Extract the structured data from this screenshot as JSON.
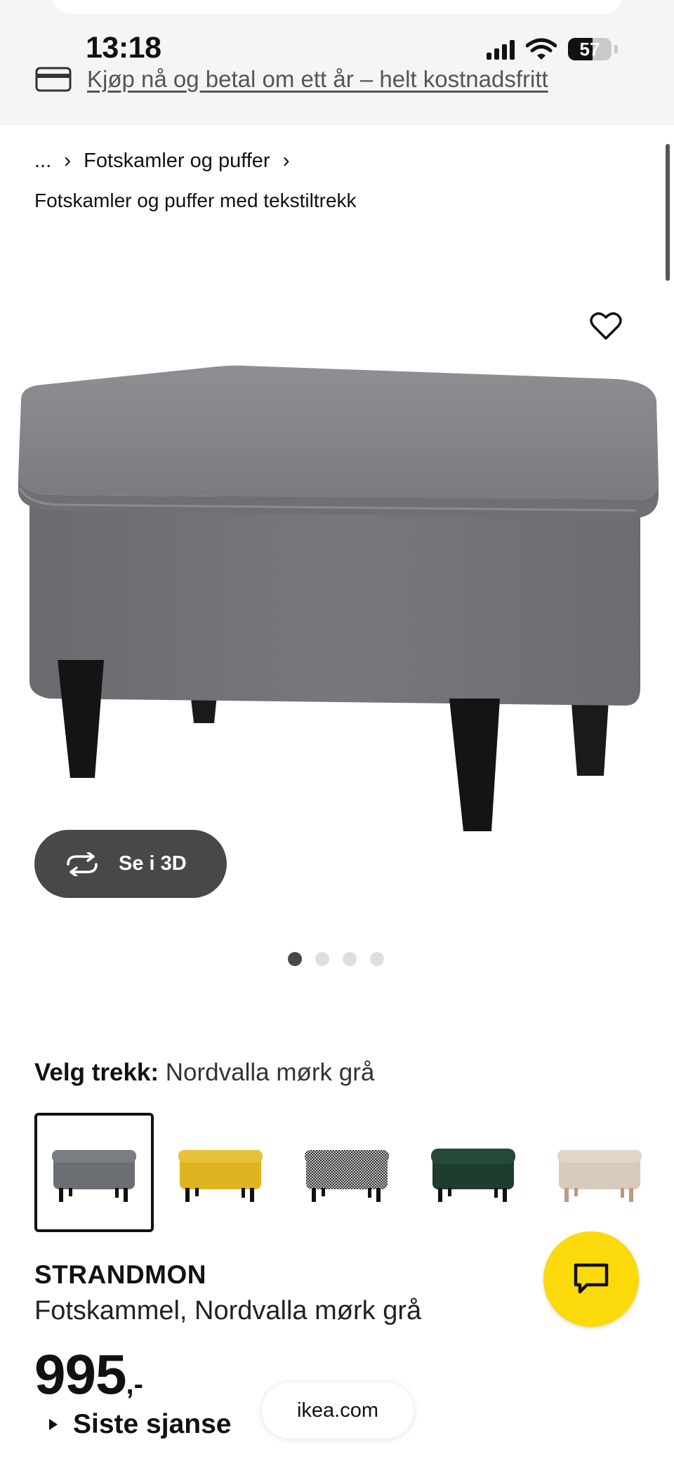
{
  "status_bar": {
    "time": "13:18",
    "battery": "57"
  },
  "promo": {
    "text": "Kjøp nå og betal om ett år – helt kostnadsfritt",
    "icon": "credit-card-icon"
  },
  "breadcrumb": {
    "ellipsis": "...",
    "category": "Fotskamler og puffer"
  },
  "subcategory": "Fotskamler og puffer med tekstiltrekk",
  "view_3d": {
    "label": "Se i 3D",
    "icon": "rotate-3d-icon"
  },
  "carousel": {
    "total": 4,
    "active_index": 0
  },
  "cover": {
    "label": "Velg trekk:",
    "value": "Nordvalla mørk grå"
  },
  "swatches": [
    {
      "color": "#6b6e72",
      "selected": true
    },
    {
      "color": "#e0b321",
      "selected": false
    },
    {
      "color": "#8d8d8d",
      "selected": false
    },
    {
      "color": "#1f3d2f",
      "selected": false
    },
    {
      "color": "#d7cbbb",
      "selected": false
    }
  ],
  "product": {
    "name": "STRANDMON",
    "description": "Fotskammel, Nordvalla mørk grå",
    "price": "995",
    "price_suffix": ",-",
    "badge": "Siste sjanse"
  },
  "browser": {
    "url": "ikea.com"
  },
  "colors": {
    "chat": "#fcd90a",
    "button_dark": "#484848"
  }
}
